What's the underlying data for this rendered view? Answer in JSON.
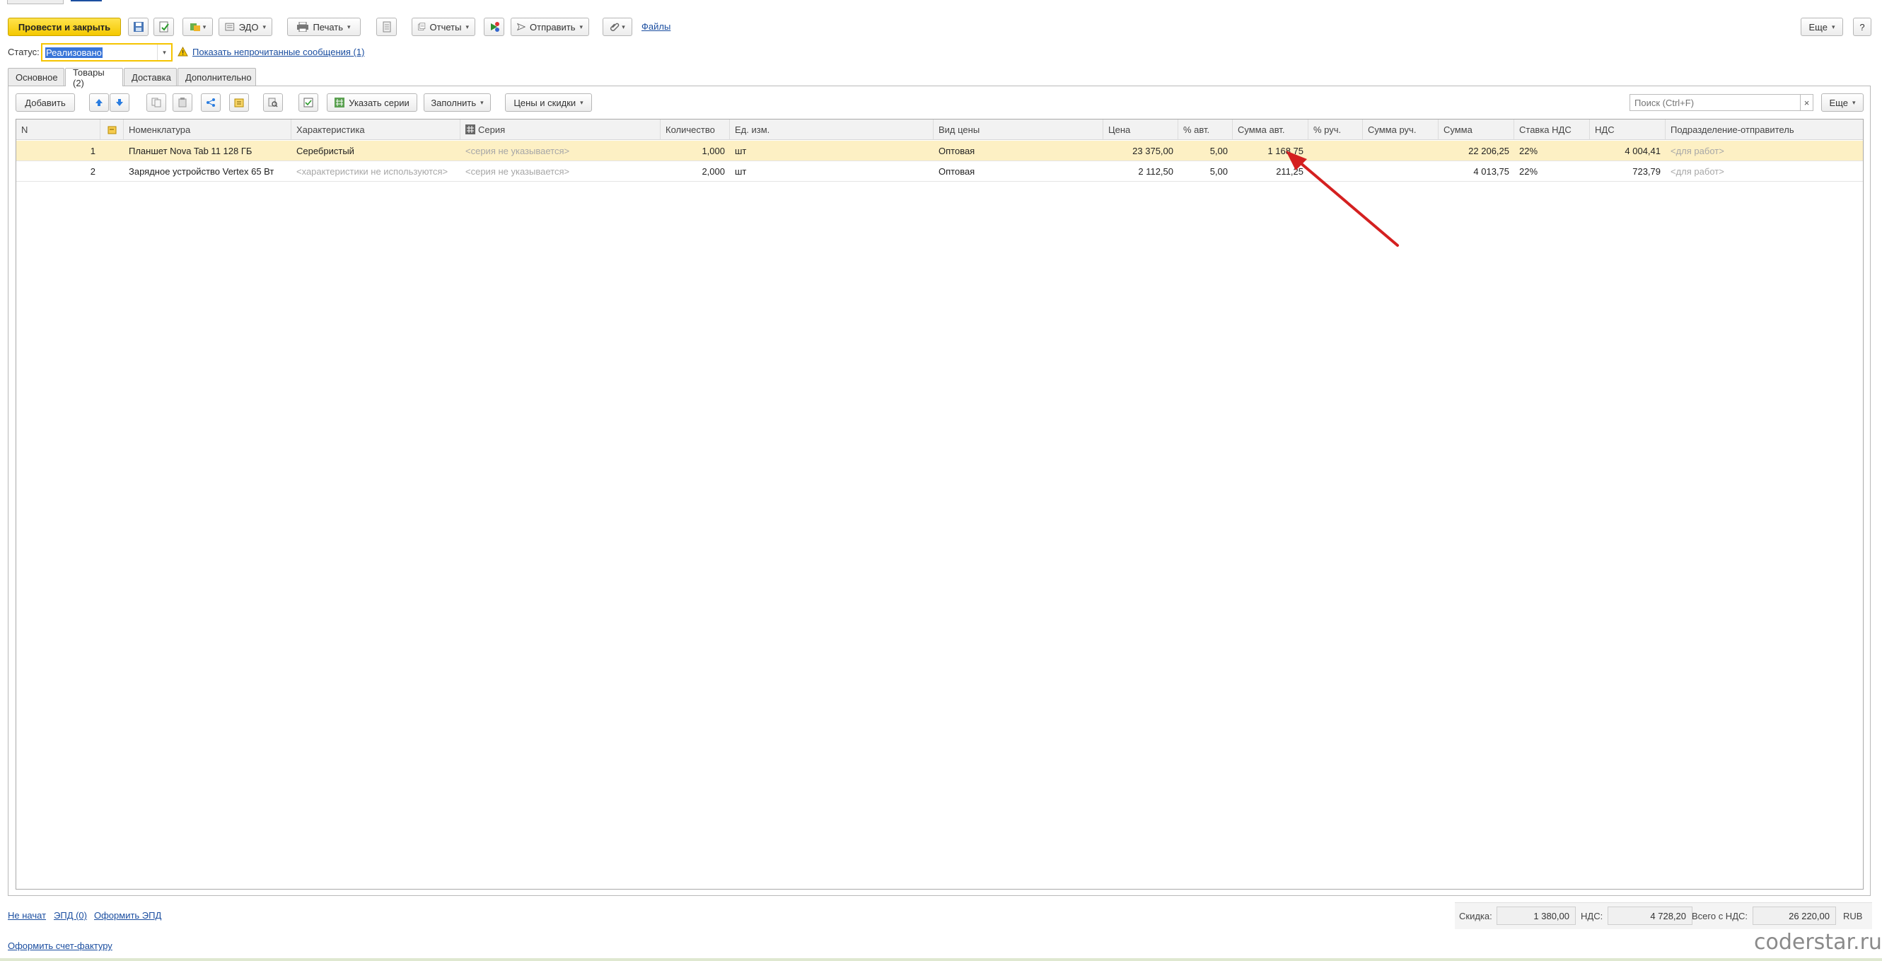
{
  "toolbar": {
    "post_close": "Провести и закрыть",
    "edo": "ЭДО",
    "print": "Печать",
    "reports": "Отчеты",
    "send": "Отправить",
    "files": "Файлы",
    "more": "Еще",
    "help": "?"
  },
  "status": {
    "label": "Статус:",
    "value": "Реализовано",
    "unread_link": "Показать непрочитанные сообщения (1)"
  },
  "tabs": [
    "Основное",
    "Товары (2)",
    "Доставка",
    "Дополнительно"
  ],
  "grid_toolbar": {
    "add": "Добавить",
    "specify_series": "Указать серии",
    "fill": "Заполнить",
    "prices_discounts": "Цены и скидки",
    "search_placeholder": "Поиск (Ctrl+F)",
    "clear": "×",
    "more": "Еще"
  },
  "columns": [
    "N",
    "",
    "Номенклатура",
    "Характеристика",
    "Серия",
    "Количество",
    "Ед. изм.",
    "Вид цены",
    "Цена",
    "% авт.",
    "Сумма авт.",
    "% руч.",
    "Сумма руч.",
    "Сумма",
    "Ставка НДС",
    "НДС",
    "Подразделение-отправитель"
  ],
  "rows": [
    {
      "n": "1",
      "item": "Планшет Nova Tab 11 128 ГБ",
      "characteristic": "Серебристый",
      "series": "<серия не указывается>",
      "qty": "1,000",
      "unit": "шт",
      "price_type": "Оптовая",
      "price": "23 375,00",
      "auto_pct": "5,00",
      "auto_sum": "1 168,75",
      "manual_pct": "",
      "manual_sum": "",
      "sum": "22 206,25",
      "vat_rate": "22%",
      "vat": "4 004,41",
      "department": "<для работ>"
    },
    {
      "n": "2",
      "item": "Зарядное устройство Vertex 65 Вт",
      "characteristic": "<характеристики не используются>",
      "series": "<серия не указывается>",
      "qty": "2,000",
      "unit": "шт",
      "price_type": "Оптовая",
      "price": "2 112,50",
      "auto_pct": "5,00",
      "auto_sum": "211,25",
      "manual_pct": "",
      "manual_sum": "",
      "sum": "4 013,75",
      "vat_rate": "22%",
      "vat": "723,79",
      "department": "<для работ>"
    }
  ],
  "footer": {
    "not_started": "Не начат",
    "epd": "ЭПД (0)",
    "make_epd": "Оформить ЭПД",
    "make_invoice": "Оформить счет-фактуру",
    "discount_label": "Скидка:",
    "discount_value": "1 380,00",
    "vat_label": "НДС:",
    "vat_value": "4 728,20",
    "total_label": "Всего с НДС:",
    "total_value": "26 220,00",
    "currency": "RUB"
  },
  "watermark": "coderstar.ru",
  "colors": {
    "primary_button": "#f4c800",
    "selected_row": "#fdf0c4",
    "link": "#1b4ea0",
    "arrow": "#d42020"
  }
}
